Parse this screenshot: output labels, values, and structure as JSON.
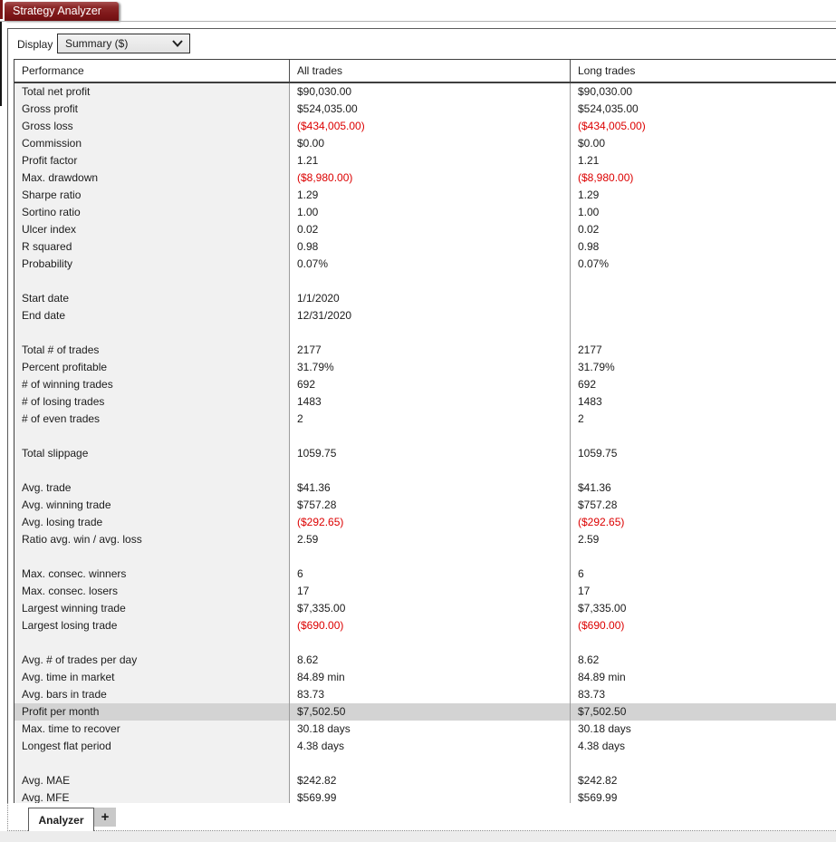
{
  "window": {
    "title_tab": "Strategy Analyzer"
  },
  "toolbar": {
    "display_label": "Display",
    "display_value": "Summary ($)"
  },
  "table": {
    "headers": [
      "Performance",
      "All trades",
      "Long trades"
    ],
    "rows": [
      {
        "label": "Total net profit",
        "all": "$90,030.00",
        "long": "$90,030.00"
      },
      {
        "label": "Gross profit",
        "all": "$524,035.00",
        "long": "$524,035.00"
      },
      {
        "label": "Gross loss",
        "all": "($434,005.00)",
        "long": "($434,005.00)"
      },
      {
        "label": "Commission",
        "all": "$0.00",
        "long": "$0.00"
      },
      {
        "label": "Profit factor",
        "all": "1.21",
        "long": "1.21"
      },
      {
        "label": "Max. drawdown",
        "all": "($8,980.00)",
        "long": "($8,980.00)"
      },
      {
        "label": "Sharpe ratio",
        "all": "1.29",
        "long": "1.29"
      },
      {
        "label": "Sortino ratio",
        "all": "1.00",
        "long": "1.00"
      },
      {
        "label": "Ulcer index",
        "all": "0.02",
        "long": "0.02"
      },
      {
        "label": "R squared",
        "all": "0.98",
        "long": "0.98"
      },
      {
        "label": "Probability",
        "all": "0.07%",
        "long": "0.07%"
      },
      {
        "label": "",
        "all": "",
        "long": ""
      },
      {
        "label": "Start date",
        "all": "1/1/2020",
        "long": ""
      },
      {
        "label": "End date",
        "all": "12/31/2020",
        "long": ""
      },
      {
        "label": "",
        "all": "",
        "long": ""
      },
      {
        "label": "Total # of trades",
        "all": "2177",
        "long": "2177"
      },
      {
        "label": "Percent profitable",
        "all": "31.79%",
        "long": "31.79%"
      },
      {
        "label": "# of winning trades",
        "all": "692",
        "long": "692"
      },
      {
        "label": "# of losing trades",
        "all": "1483",
        "long": "1483"
      },
      {
        "label": "# of even trades",
        "all": "2",
        "long": "2"
      },
      {
        "label": "",
        "all": "",
        "long": ""
      },
      {
        "label": "Total slippage",
        "all": "1059.75",
        "long": "1059.75"
      },
      {
        "label": "",
        "all": "",
        "long": ""
      },
      {
        "label": "Avg. trade",
        "all": "$41.36",
        "long": "$41.36"
      },
      {
        "label": "Avg. winning trade",
        "all": "$757.28",
        "long": "$757.28"
      },
      {
        "label": "Avg. losing trade",
        "all": "($292.65)",
        "long": "($292.65)"
      },
      {
        "label": "Ratio avg. win / avg. loss",
        "all": "2.59",
        "long": "2.59"
      },
      {
        "label": "",
        "all": "",
        "long": ""
      },
      {
        "label": "Max. consec. winners",
        "all": "6",
        "long": "6"
      },
      {
        "label": "Max. consec. losers",
        "all": "17",
        "long": "17"
      },
      {
        "label": "Largest winning trade",
        "all": "$7,335.00",
        "long": "$7,335.00"
      },
      {
        "label": "Largest losing trade",
        "all": "($690.00)",
        "long": "($690.00)"
      },
      {
        "label": "",
        "all": "",
        "long": ""
      },
      {
        "label": "Avg. # of trades per day",
        "all": "8.62",
        "long": "8.62"
      },
      {
        "label": "Avg. time in market",
        "all": "84.89 min",
        "long": "84.89 min"
      },
      {
        "label": "Avg. bars in trade",
        "all": "83.73",
        "long": "83.73"
      },
      {
        "label": "Profit per month",
        "all": "$7,502.50",
        "long": "$7,502.50",
        "highlight": true
      },
      {
        "label": "Max. time to recover",
        "all": "30.18 days",
        "long": "30.18 days"
      },
      {
        "label": "Longest flat period",
        "all": "4.38 days",
        "long": "4.38 days"
      },
      {
        "label": "",
        "all": "",
        "long": ""
      },
      {
        "label": "Avg. MAE",
        "all": "$242.82",
        "long": "$242.82"
      },
      {
        "label": "Avg. MFE",
        "all": "$569.99",
        "long": "$569.99"
      }
    ]
  },
  "bottom_tabs": {
    "active": "Analyzer",
    "add_label": "+"
  },
  "colors": {
    "accent_maroon": "#7c1517",
    "negative_value": "#dc0000",
    "row_highlight": "#d3d3d3",
    "label_column_bg": "#f1f1f1"
  }
}
